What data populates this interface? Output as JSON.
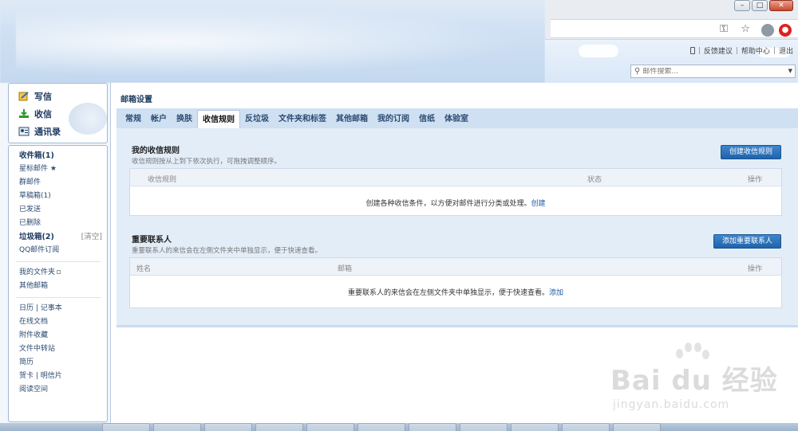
{
  "browser": {
    "window_controls": {
      "minimize": "–",
      "maximize": "□",
      "close": "✕"
    },
    "icons": [
      "key-icon",
      "star-icon",
      "profile-icon",
      "adblock-icon"
    ]
  },
  "header": {
    "links": [
      "反馈建议",
      "帮助中心",
      "退出"
    ],
    "separator": "|",
    "search_placeholder": "邮件搜索..."
  },
  "sidebar": {
    "actions": [
      {
        "label": "写信",
        "icon": "compose-icon"
      },
      {
        "label": "收信",
        "icon": "inbox-download-icon"
      },
      {
        "label": "通讯录",
        "icon": "contacts-icon"
      }
    ],
    "folders": [
      {
        "label": "收件箱(1)",
        "bold": true
      },
      {
        "label": "星标邮件 ★",
        "bold": false
      },
      {
        "label": "群邮件",
        "bold": false
      },
      {
        "label": "草稿箱(1)",
        "bold": false
      },
      {
        "label": "已发送",
        "bold": false
      },
      {
        "label": "已删除",
        "bold": false
      },
      {
        "label": "垃圾箱(2)",
        "bold": true,
        "extra": "[清空]"
      },
      {
        "label": "QQ邮件订阅",
        "bold": false
      }
    ],
    "my_folders": [
      "我的文件夹",
      "其他邮箱"
    ],
    "tools": [
      "日历 | 记事本",
      "在线文档",
      "附件收藏",
      "文件中转站",
      "简历",
      "贺卡 | 明信片",
      "阅读空间"
    ]
  },
  "main": {
    "title": "邮箱设置",
    "tabs": [
      "常规",
      "帐户",
      "换肤",
      "收信规则",
      "反垃圾",
      "文件夹和标签",
      "其他邮箱",
      "我的订阅",
      "信纸",
      "体验室"
    ],
    "active_tab": "收信规则",
    "rules": {
      "title": "我的收信规则",
      "desc": "收信规则按从上到下依次执行，可拖拽调整顺序。",
      "button": "创建收信规则",
      "columns": [
        "收信规则",
        "状态",
        "操作"
      ],
      "empty_text": "创建各种收信条件，以方便对邮件进行分类或处理。",
      "empty_link": "创建"
    },
    "contacts": {
      "title": "重要联系人",
      "desc": "重要联系人的来信会在左侧文件夹中单独显示，便于快速查看。",
      "button": "添加重要联系人",
      "columns": [
        "姓名",
        "邮箱",
        "操作"
      ],
      "empty_text": "重要联系人的来信会在左侧文件夹中单独显示，便于快速查看。",
      "empty_link": "添加"
    }
  },
  "watermark": {
    "logo": "Bai du 经验",
    "url": "jingyan.baidu.com"
  }
}
